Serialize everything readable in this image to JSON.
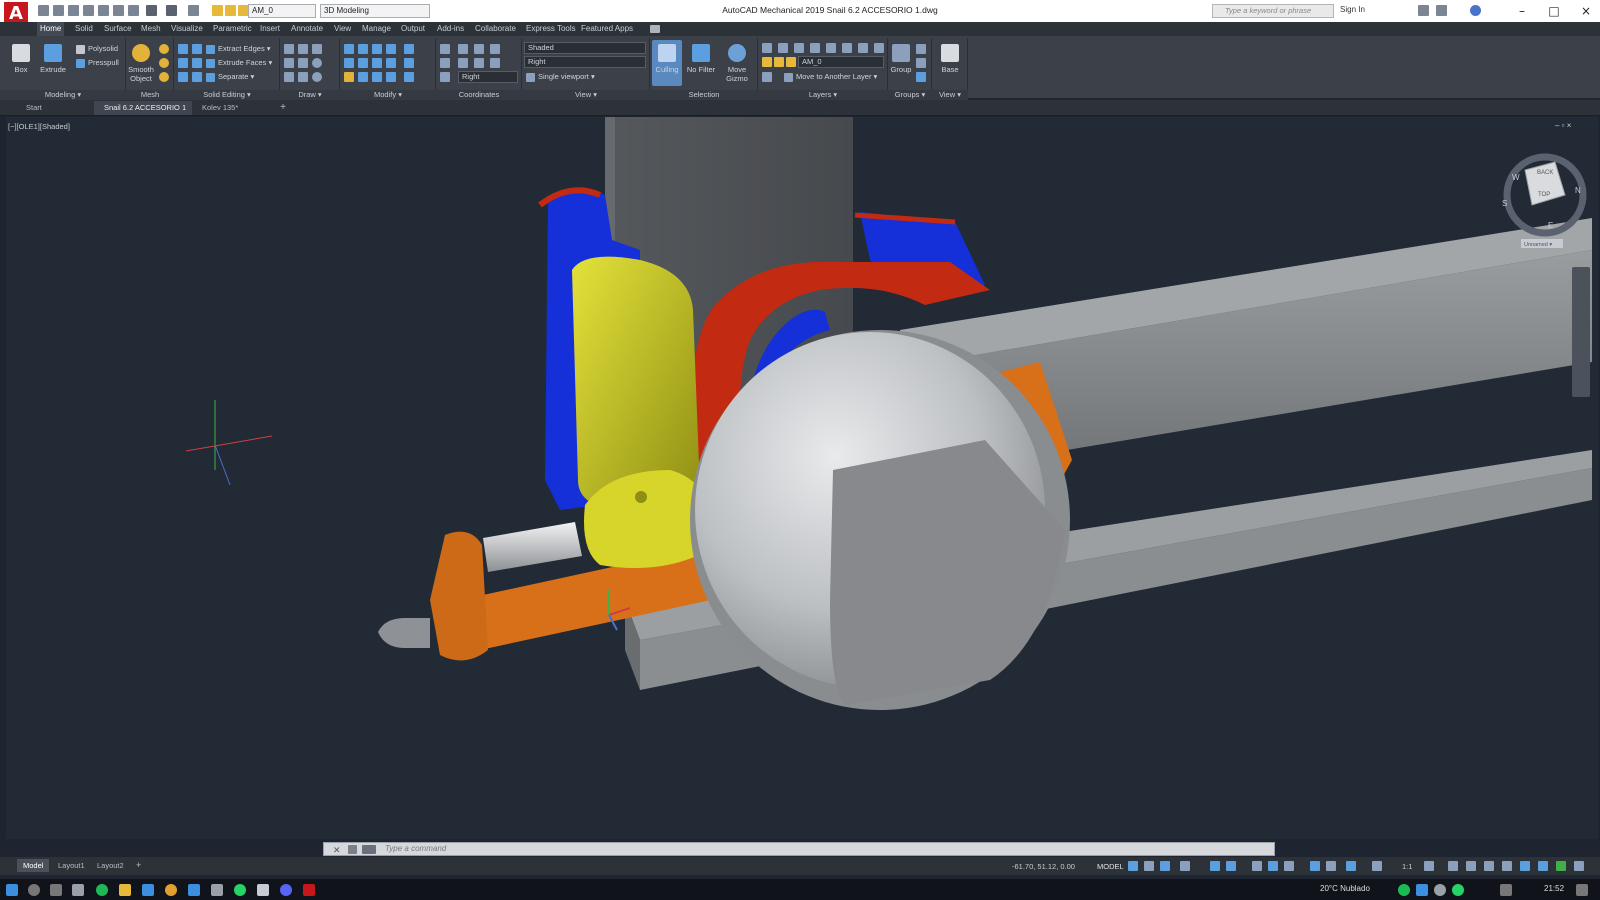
{
  "app": {
    "logo": "A",
    "title": "AutoCAD Mechanical 2019    Snail 6.2 ACCESORIO 1.dwg",
    "layer_quick": "AM_0",
    "workspace": "3D Modeling",
    "search_placeholder": "Type a keyword or phrase",
    "sign_in": "Sign In"
  },
  "ribbon_tabs": [
    "Home",
    "Solid",
    "Surface",
    "Mesh",
    "Visualize",
    "Parametric",
    "Insert",
    "Annotate",
    "View",
    "Manage",
    "Output",
    "Add-ins",
    "Collaborate",
    "Express Tools",
    "Featured Apps"
  ],
  "ribbon": {
    "modeling": {
      "box": "Box",
      "extrude": "Extrude",
      "polysolid": "Polysolid",
      "presspull": "Presspull",
      "label": "Modeling ▾"
    },
    "mesh": {
      "smooth": "Smooth Object",
      "label": "Mesh"
    },
    "solid_editing": {
      "extract_edges": "Extract Edges ▾",
      "extrude_faces": "Extrude Faces ▾",
      "separate": "Separate ▾",
      "label": "Solid Editing ▾"
    },
    "draw": {
      "label": "Draw ▾"
    },
    "modify": {
      "label": "Modify ▾"
    },
    "coordinates": {
      "ucs_view": "Right",
      "label": "Coordinates"
    },
    "view": {
      "visual_style": "Shaded",
      "view_dir": "Right",
      "viewport": "Single viewport ▾",
      "label": "View ▾"
    },
    "selection": {
      "culling": "Culling",
      "no_filter": "No Filter",
      "move_gizmo": "Move Gizmo",
      "label": "Selection"
    },
    "layers": {
      "layer": "AM_0",
      "move_layer": "Move to Another Layer ▾",
      "label": "Layers ▾"
    },
    "groups": {
      "group": "Group",
      "label": "Groups ▾"
    },
    "view2": {
      "base": "Base",
      "label": "View ▾"
    }
  },
  "file_tabs": [
    "Start",
    "Snail 6.2 ACCESORIO 1",
    "Kolev 135*"
  ],
  "viewport": {
    "label": "[−][OLE1][Shaded]",
    "viewcube": {
      "top": "TOP",
      "back": "BACK",
      "north": "N",
      "south": "S",
      "east": "E",
      "west": "W",
      "ucs": "Unnamed ▾"
    }
  },
  "command": {
    "placeholder": "Type a command"
  },
  "layout_tabs": [
    "Model",
    "Layout1",
    "Layout2"
  ],
  "status": {
    "coords": "-61.70, 51.12, 0.00",
    "model": "MODEL",
    "scale": "1:1"
  },
  "taskbar": {
    "weather": "20°C  Nublado",
    "time": "21:52"
  },
  "colors": {
    "blue": "#1530d8",
    "red": "#c32a12",
    "yellow": "#c9c82a",
    "orange": "#d8701a",
    "silver": "#c7cbd0",
    "gray": "#8a8d90",
    "bg": "#212a35"
  }
}
